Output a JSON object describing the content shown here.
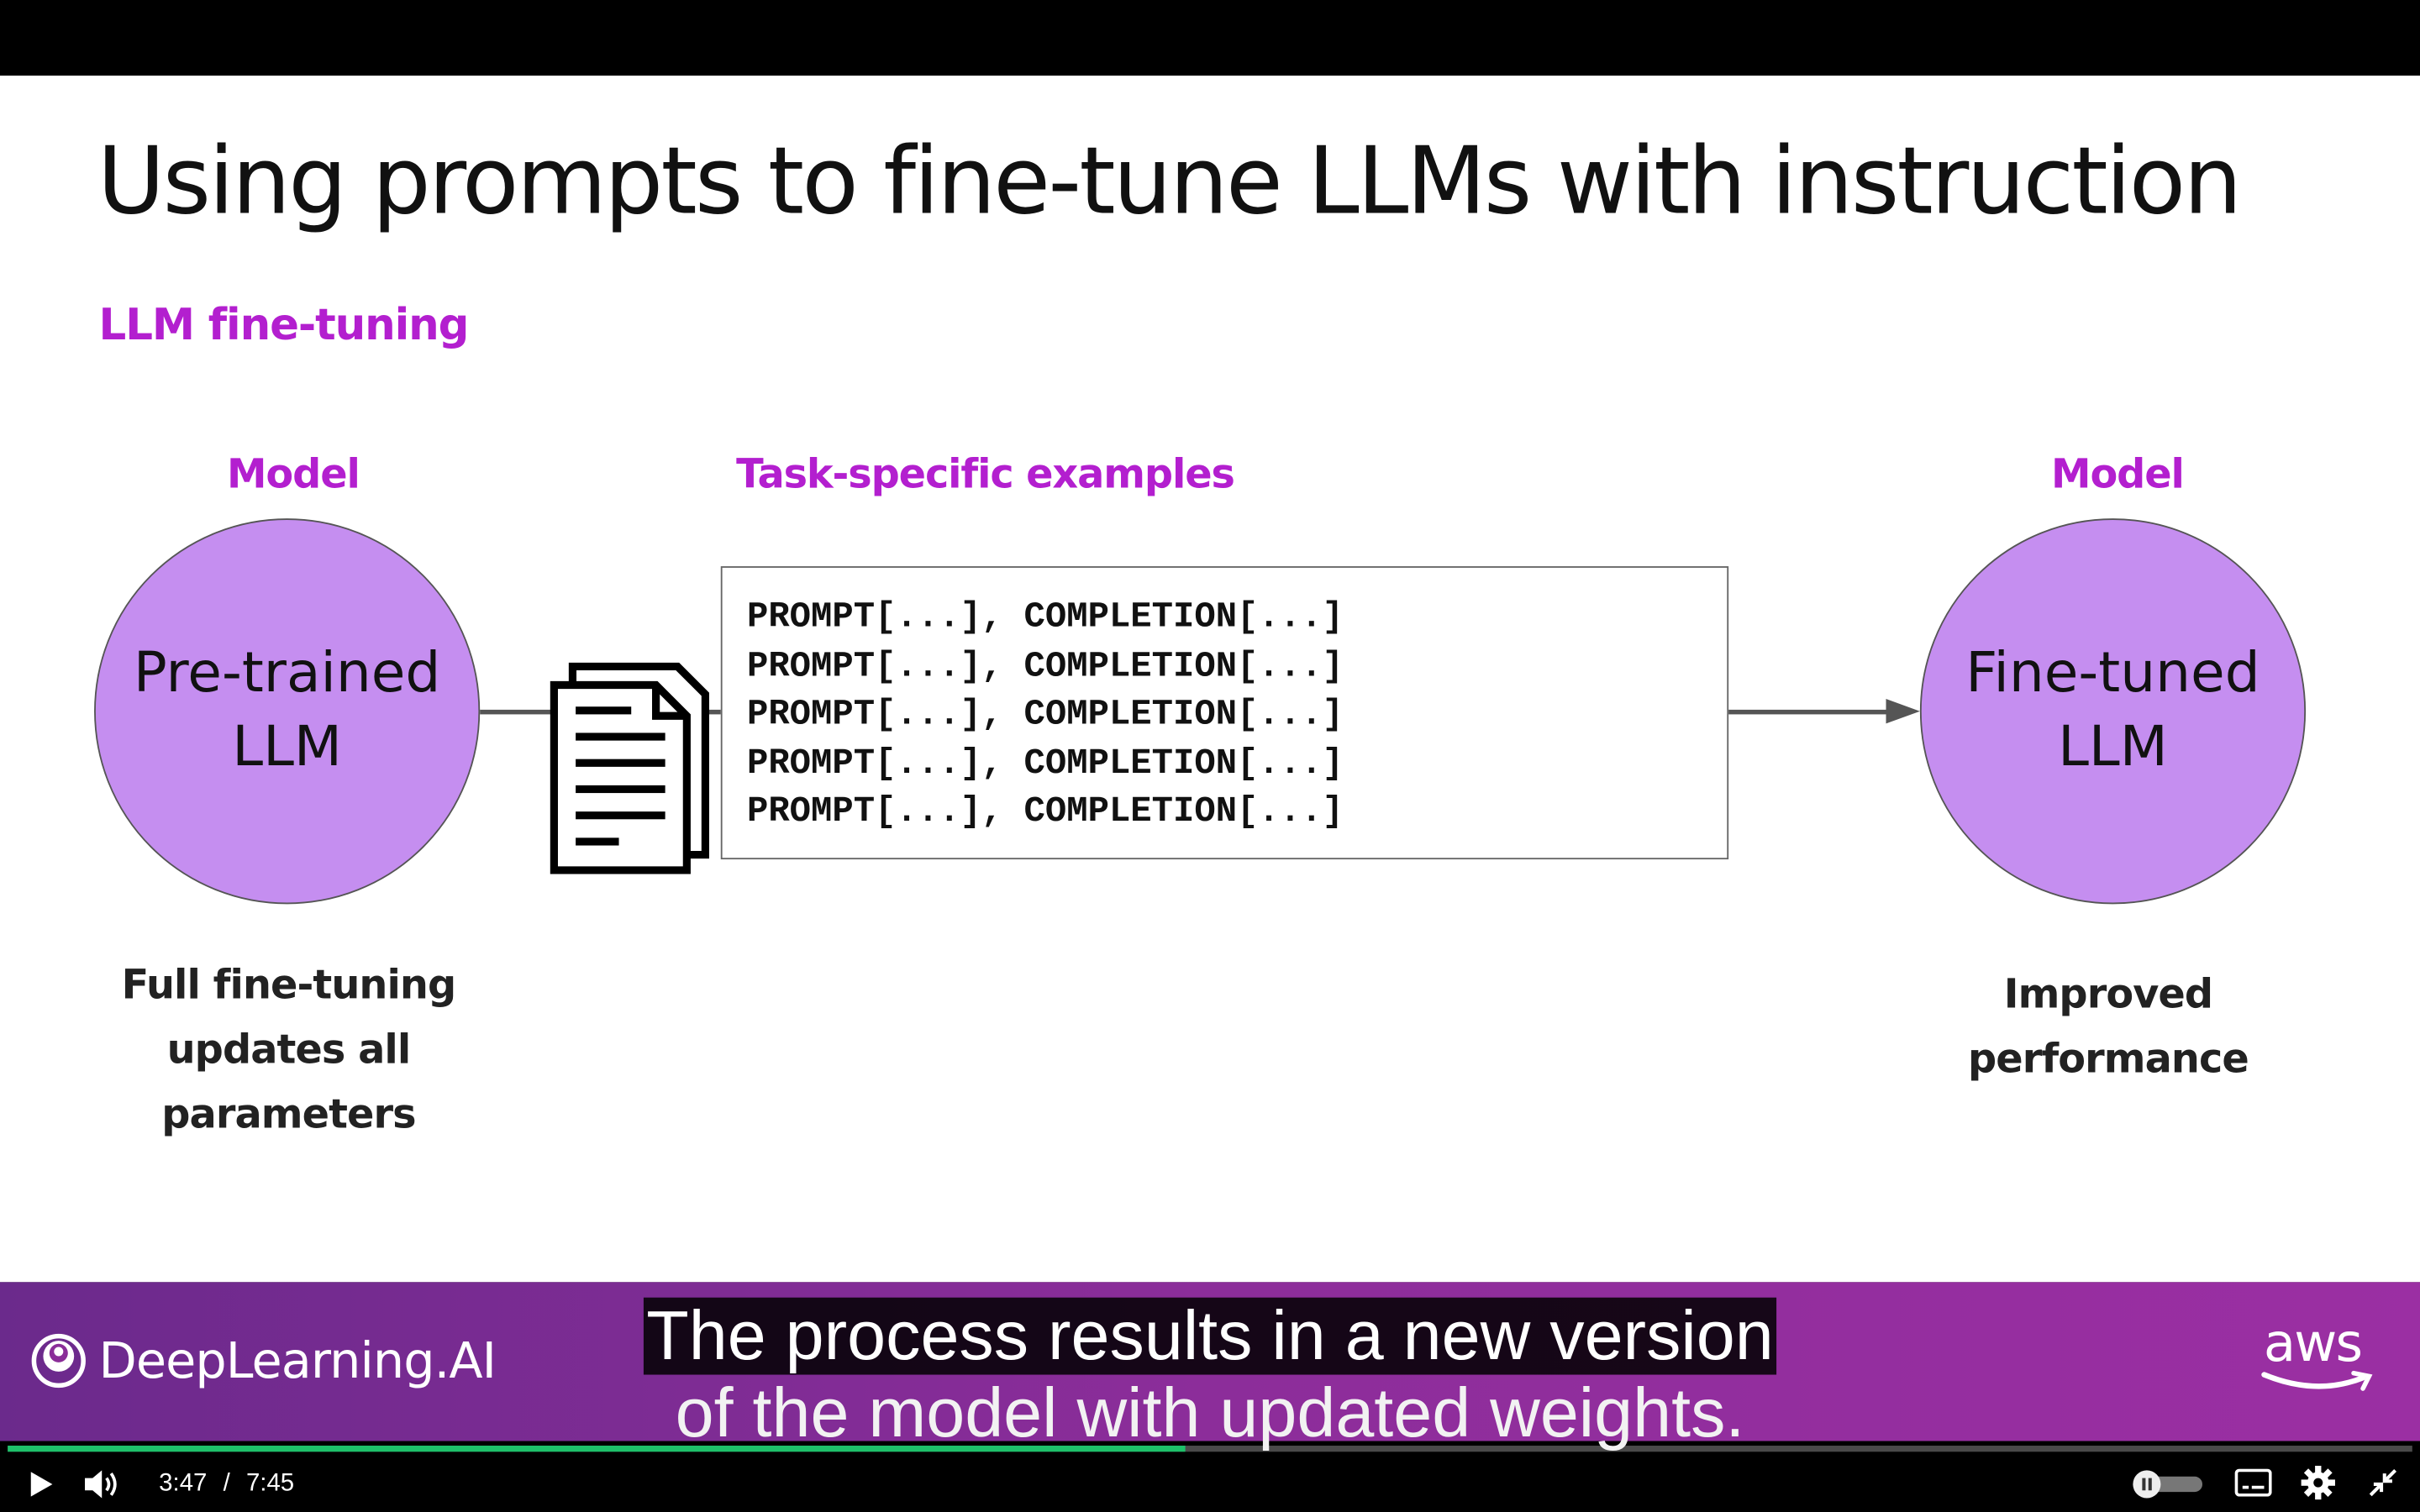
{
  "slide": {
    "title": "Using prompts to fine-tune LLMs with instruction",
    "subtitle": "LLM fine-tuning",
    "left_model": {
      "label": "Model",
      "circle_text": "Pre-trained\nLLM",
      "caption": "Full fine-tuning\nupdates all parameters"
    },
    "examples": {
      "label": "Task-specific examples",
      "lines": [
        "PROMPT[...], COMPLETION[...]",
        "PROMPT[...], COMPLETION[...]",
        "PROMPT[...], COMPLETION[...]",
        "PROMPT[...], COMPLETION[...]",
        "PROMPT[...], COMPLETION[...]"
      ]
    },
    "right_model": {
      "label": "Model",
      "circle_text": "Fine-tuned\nLLM",
      "caption": "Improved\nperformance"
    }
  },
  "branding": {
    "left_logo": "DeepLearning.AI",
    "right_logo": "aws"
  },
  "subtitles": {
    "line1": "The process results in a new version",
    "line2": "of the model with updated weights."
  },
  "player": {
    "current_time": "3:47",
    "separator": "/",
    "duration": "7:45",
    "progress_fraction": 0.49,
    "icons": [
      "play-icon",
      "volume-icon",
      "autoplay-toggle-icon",
      "captions-icon",
      "settings-gear-icon",
      "exit-fullscreen-icon"
    ]
  },
  "colors": {
    "accent_purple": "#b31fcf",
    "circle_fill": "#c58ef0",
    "progress_green": "#1ec06a"
  }
}
